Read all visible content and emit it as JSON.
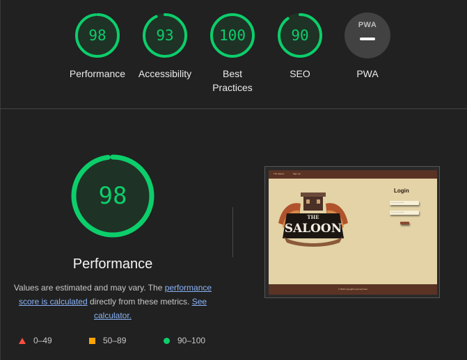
{
  "categories": [
    {
      "id": "performance",
      "score": "98",
      "label": "Performance"
    },
    {
      "id": "accessibility",
      "score": "93",
      "label": "Accessibility"
    },
    {
      "id": "best-practices",
      "score": "100",
      "label_line1": "Best",
      "label_line2": "Practices"
    },
    {
      "id": "seo",
      "score": "90",
      "label": "SEO"
    },
    {
      "id": "pwa",
      "badge": "PWA",
      "label": "PWA"
    }
  ],
  "scores_fraction": {
    "performance": 0.98,
    "accessibility": 0.93,
    "best_practices": 1.0,
    "seo": 0.9,
    "main_performance": 0.98
  },
  "main": {
    "score": "98",
    "title": "Performance",
    "note_prefix": "Values are estimated and may vary. The ",
    "note_link1": "performance score is calculated",
    "note_middle": " directly from these metrics. ",
    "note_link2": "See calculator."
  },
  "legend": {
    "fail": "0–49",
    "average": "50–89",
    "pass": "90–100"
  },
  "thumbnail": {
    "nav_brand": "The Saloon",
    "nav_link": "Sign Up",
    "logo_top": "THE",
    "logo_main": "SALOON",
    "login_title": "Login",
    "username_placeholder": "Enter your username",
    "password_placeholder": "Enter your password",
    "footer": "© 2023 copyright reserved here"
  },
  "colors": {
    "pass": "#0cce6b",
    "average": "#ffa400",
    "fail": "#ff4e42",
    "background": "#212121",
    "link": "#8ab4f8"
  }
}
